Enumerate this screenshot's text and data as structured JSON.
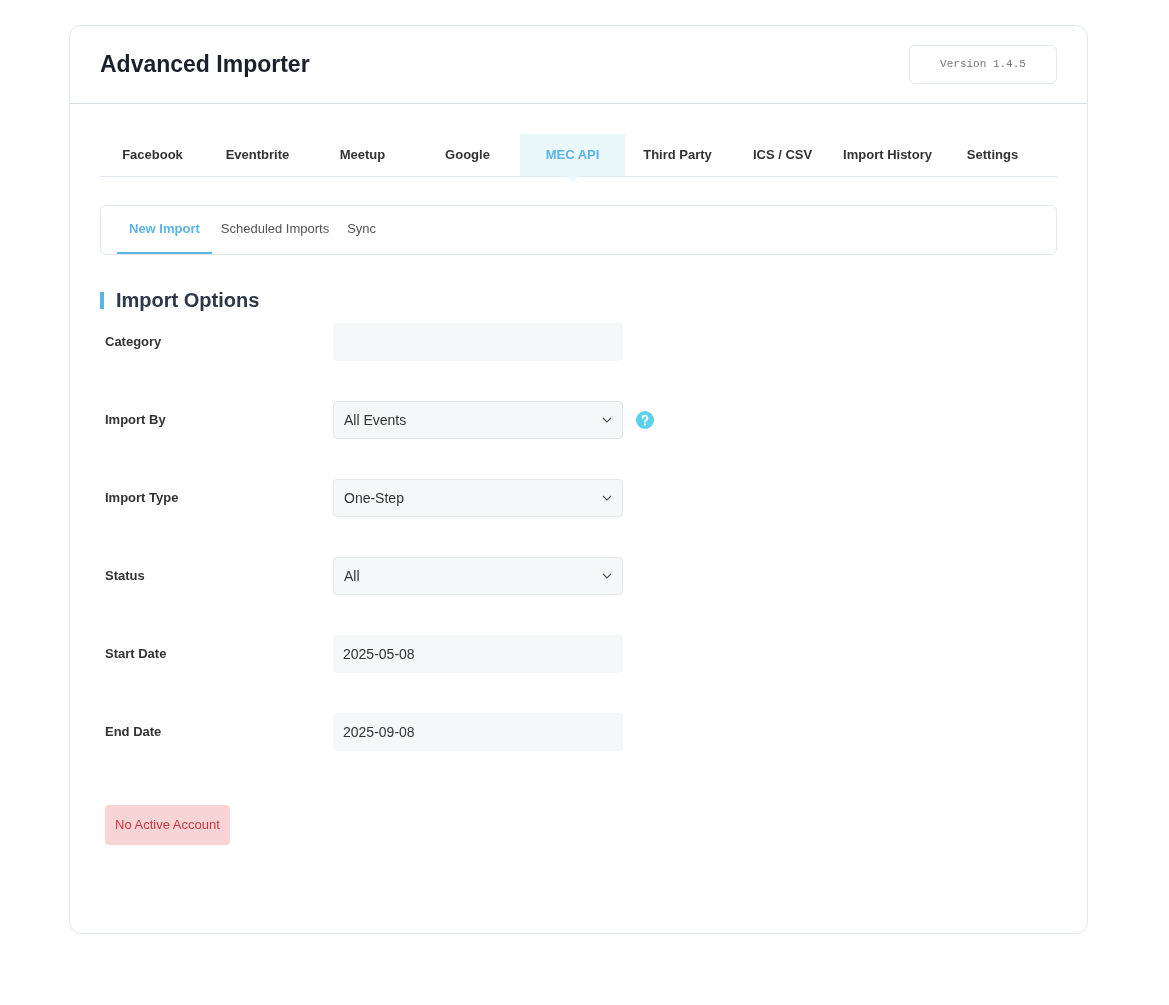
{
  "header": {
    "title": "Advanced Importer",
    "version": "Version 1.4.5"
  },
  "tabs": [
    {
      "label": "Facebook",
      "selected": false
    },
    {
      "label": "Eventbrite",
      "selected": false
    },
    {
      "label": "Meetup",
      "selected": false
    },
    {
      "label": "Google",
      "selected": false
    },
    {
      "label": "MEC API",
      "selected": true
    },
    {
      "label": "Third Party",
      "selected": false
    },
    {
      "label": "ICS / CSV",
      "selected": false
    },
    {
      "label": "Import History",
      "selected": false
    },
    {
      "label": "Settings",
      "selected": false
    }
  ],
  "subtabs": [
    {
      "label": "New Import",
      "selected": true
    },
    {
      "label": "Scheduled Imports",
      "selected": false
    },
    {
      "label": "Sync",
      "selected": false
    }
  ],
  "section_title": "Import Options",
  "fields": [
    {
      "label": "Category",
      "kind": "text",
      "help": false
    },
    {
      "label": "Import By",
      "kind": "select",
      "value": "All Events",
      "help": true
    },
    {
      "label": "Import Type",
      "kind": "select",
      "value": "One-Step",
      "help": false
    },
    {
      "label": "Status",
      "kind": "select",
      "value": "All",
      "help": false
    },
    {
      "label": "Start Date",
      "kind": "text",
      "value": "2025-05-08",
      "help": false
    },
    {
      "label": "End Date",
      "kind": "text",
      "value": "2025-09-08",
      "help": false
    }
  ],
  "alert": "No Active Account"
}
